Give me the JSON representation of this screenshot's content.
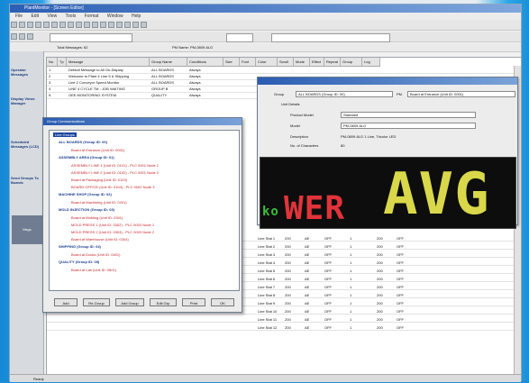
{
  "colors": {
    "led_green": "#3bbf3b",
    "led_red": "#e0343a",
    "led_yellow": "#d8d84a",
    "tree_group": "#1a3d8f",
    "tree_item": "#c8242a"
  },
  "window": {
    "title": "PlantMonitor - [Screen Editor]"
  },
  "menu": [
    "File",
    "Edit",
    "View",
    "Tools",
    "Format",
    "Window",
    "Help"
  ],
  "left_panel": [
    "Operator Messages",
    "Display Views Manager",
    "Scheduled Messages (LCD)",
    "Send Groups To Boards"
  ],
  "left_panel_selected": "Msgs",
  "grid": {
    "toolbar_left": "Total Messages: 62",
    "toolbar_right": "PM Name: PM-0809-6LG",
    "columns": [
      "No.",
      "Tp",
      "Message",
      "Group Name",
      "Conditions",
      "Size",
      "Font",
      "Color",
      "Scroll",
      "Mode",
      "Effect",
      "Repeat",
      "Group",
      "Log"
    ],
    "rows": [
      [
        "1",
        "",
        "Default Message to All On-Display",
        "ALL BOARDS",
        "Always"
      ],
      [
        "2",
        "",
        "Welcome to Plant 4 Line 5 & Shipping",
        "ALL BOARDS",
        "Always"
      ],
      [
        "3",
        "",
        "Line 2 Conveyor Speed Monitor",
        "ALL BOARDS",
        "Always"
      ],
      [
        "4",
        "",
        "LINE 4 CYCLE TM - JOB WAITING",
        "GROUP B",
        "Always"
      ],
      [
        "5",
        "",
        "OEE MONITORING SYSTEM",
        "QUALITY",
        "Always"
      ]
    ],
    "lower_rows": [
      [
        "Line Stat 1",
        "200",
        "AE",
        "OFF",
        "1",
        "200",
        "OFF"
      ],
      [
        "Line Stat 2",
        "200",
        "AE",
        "OFF",
        "1",
        "200",
        "OFF"
      ],
      [
        "Line Stat 3",
        "200",
        "AE",
        "OFF",
        "1",
        "200",
        "OFF"
      ],
      [
        "Line Stat 4",
        "200",
        "AE",
        "OFF",
        "1",
        "200",
        "OFF"
      ],
      [
        "Line Stat 5",
        "200",
        "AE",
        "OFF",
        "1",
        "200",
        "OFF"
      ],
      [
        "Line Stat 6",
        "200",
        "AE",
        "OFF",
        "1",
        "200",
        "OFF"
      ],
      [
        "Line Stat 7",
        "200",
        "AE",
        "OFF",
        "1",
        "200",
        "OFF"
      ],
      [
        "Line Stat 8",
        "200",
        "AE",
        "OFF",
        "1",
        "200",
        "OFF"
      ],
      [
        "Line Stat 9",
        "200",
        "AE",
        "OFF",
        "1",
        "200",
        "OFF"
      ],
      [
        "Line Stat 10",
        "200",
        "AE",
        "OFF",
        "1",
        "200",
        "OFF"
      ],
      [
        "Line Stat 11",
        "200",
        "AE",
        "OFF",
        "1",
        "200",
        "OFF"
      ],
      [
        "Line Stat 12",
        "200",
        "AE",
        "OFF",
        "1",
        "200",
        "OFF"
      ]
    ]
  },
  "dialog": {
    "title": "Group Communications",
    "root": "Line Groups",
    "tree": [
      {
        "t": "grp",
        "label": "ALL BOARDS (Group ID: 00)"
      },
      {
        "t": "item",
        "label": "Board at Entrance (Unit ID: 0001)"
      },
      {
        "t": "grp",
        "label": "ASSEMBLY AREA (Group ID: 01)"
      },
      {
        "t": "item",
        "label": "ASSEMBLY LINE 1 (Unit ID: 0101) - PLC 0001 Node 1"
      },
      {
        "t": "item",
        "label": "ASSEMBLY LINE 2 (Unit ID: 0102) - PLC 0001 Node 2"
      },
      {
        "t": "item",
        "label": "Board at Packaging (Unit ID: 0103)"
      },
      {
        "t": "item",
        "label": "BOARD OFFICE (Unit ID: 0104) - PLC 0002 Node 3"
      },
      {
        "t": "grp",
        "label": "MACHINE SHOP (Group ID: 02)"
      },
      {
        "t": "item",
        "label": "Board at Machining (Unit ID: 0201)"
      },
      {
        "t": "grp",
        "label": "MOLD INJECTION (Group ID: 03)"
      },
      {
        "t": "item",
        "label": "Board at Molding (Unit ID: 0301)"
      },
      {
        "t": "item",
        "label": "MOLD PRESS 1 (Unit ID: 0302) - PLC 0003 Node 1"
      },
      {
        "t": "item",
        "label": "MOLD PRESS 2 (Unit ID: 0303) - PLC 0003 Node 2"
      },
      {
        "t": "item",
        "label": "Board at Warehouse (Unit ID: 0304)"
      },
      {
        "t": "grp",
        "label": "SHIPPING (Group ID: 04)"
      },
      {
        "t": "item",
        "label": "Board at Docks (Unit ID: 0401)"
      },
      {
        "t": "grp",
        "label": "QUALITY (Group ID: 05)"
      },
      {
        "t": "item",
        "label": "Board at Lab (Unit ID: 0501)"
      }
    ],
    "buttons": [
      "Add",
      "Re-Group",
      "Add Group",
      "Edit Grp",
      "Print",
      "OK"
    ]
  },
  "props": {
    "group_label": "Group",
    "group_value": "ALL BOARDS (Group ID: 00)",
    "pm_label": "PM",
    "pm_value": "Board at Entrance (Unit ID: 0001)",
    "section": "Unit Details",
    "fields": [
      {
        "label": "Product Model",
        "value": "Standard"
      },
      {
        "label": "Model",
        "value": "PM-0809-6LG"
      },
      {
        "label": "Description",
        "value": "PM-0809-6LG 1 Line, Tricolor LED"
      },
      {
        "label": "No. of Characters",
        "value": "80"
      }
    ]
  },
  "led": {
    "part1": "ko",
    "part2": "WER",
    "part3": "AVG"
  },
  "status": {
    "text": "Ready"
  }
}
